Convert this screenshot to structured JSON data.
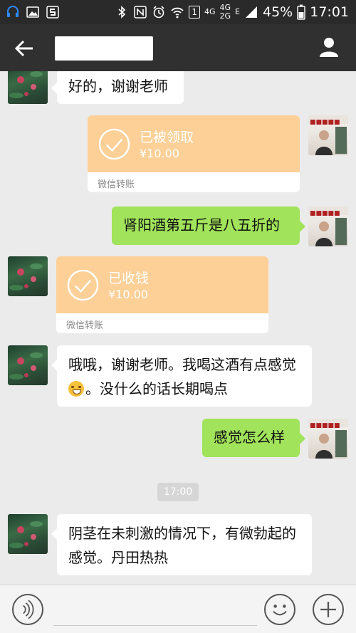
{
  "status_bar": {
    "network_small": "4G",
    "network_box": "1",
    "network_dual_top": "4G",
    "network_dual_bottom": "2G",
    "network_e": "E",
    "battery": "45%",
    "time": "17:01",
    "icons": [
      "headset-icon",
      "image-icon",
      "s-app-icon",
      "bluetooth-icon",
      "nfc-icon",
      "alarm-icon",
      "wifi-icon",
      "sim-icon",
      "signal-icon",
      "battery-icon"
    ]
  },
  "header": {
    "title": "",
    "back_icon": "arrow-left-icon",
    "profile_icon": "person-icon"
  },
  "messages": [
    {
      "type": "text",
      "side": "left",
      "text": "好的，谢谢老师"
    },
    {
      "type": "transfer",
      "side": "right",
      "status": "已被领取",
      "amount": "¥10.00",
      "footer": "微信转账"
    },
    {
      "type": "text",
      "side": "right",
      "text": "肾阳酒第五斤是八五折的"
    },
    {
      "type": "transfer",
      "side": "left",
      "status": "已收钱",
      "amount": "¥10.00",
      "footer": "微信转账"
    },
    {
      "type": "text",
      "side": "left",
      "text_line1": "哦哦，谢谢老师。我喝这酒有点感觉",
      "text_line2": "。没什么的话长期喝点"
    },
    {
      "type": "text",
      "side": "right",
      "text": "感觉怎么样"
    },
    {
      "type": "time",
      "text": "17:00"
    },
    {
      "type": "text",
      "side": "left",
      "text_line1": "阴茎在未刺激的情况下，有微勃起的",
      "text_line2": "感觉。丹田热热"
    }
  ],
  "input_bar": {
    "voice_icon": "voice-icon",
    "emoji_icon": "emoji-icon",
    "plus_icon": "plus-icon"
  },
  "colors": {
    "header_bg": "#303030",
    "chat_bg": "#ebebeb",
    "green_bubble": "#a1e35a",
    "transfer_orange": "#fcd097"
  }
}
